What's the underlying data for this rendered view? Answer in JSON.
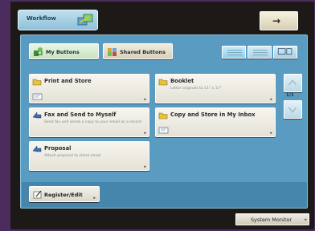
{
  "header": {
    "app_title": "Workflow",
    "arrow_glyph": "→"
  },
  "tabs": {
    "my_buttons": "My Buttons",
    "shared_buttons": "Shared Buttons"
  },
  "buttons": [
    {
      "title": "Print and Store",
      "subtitle": ""
    },
    {
      "title": "Booklet",
      "subtitle": "Letter originals to 11\" x 17\""
    },
    {
      "title": "Fax and Send to Myself",
      "subtitle": "Send fax and sends a copy to your email as a record"
    },
    {
      "title": "Copy and Store in My Inbox",
      "subtitle": ""
    },
    {
      "title": "Proposal",
      "subtitle": "Attach proposal to client email"
    }
  ],
  "pagination": {
    "indicator": "1/1"
  },
  "footer": {
    "register_label": "Register/Edit",
    "system_monitor_label": "System Monitor"
  },
  "colors": {
    "panel": "#5a9bc1",
    "bezel": "#4a2d5c",
    "card": "#f7f5ef"
  },
  "icons": [
    "workflow-icon",
    "my-buttons-icon",
    "shared-buttons-icon",
    "list-view-icon",
    "small-icon-view-icon",
    "large-icon-view-icon",
    "folder-icon",
    "document-icon",
    "fax-icon",
    "register-edit-icon",
    "scroll-up-icon",
    "scroll-down-icon"
  ]
}
